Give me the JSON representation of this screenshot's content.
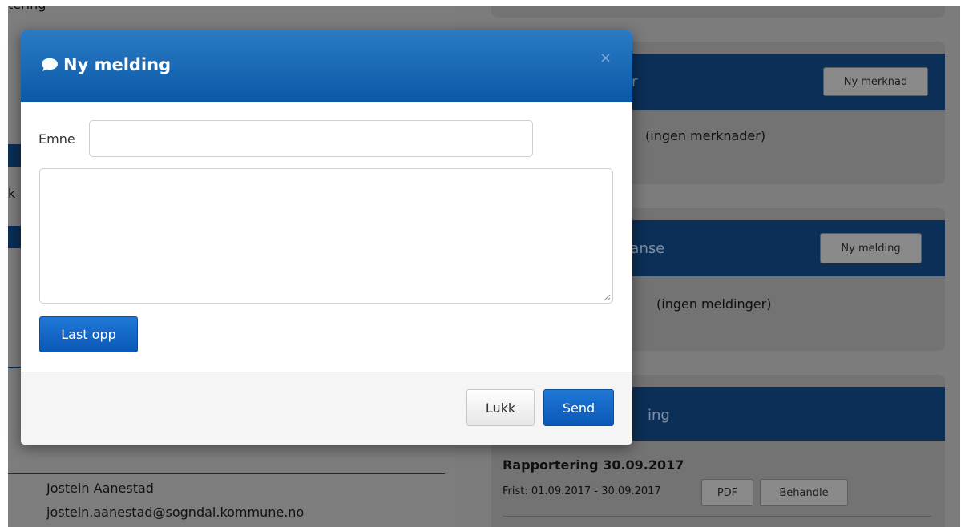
{
  "background": {
    "left": {
      "clipped_top": "tering",
      "clipped_mid": "k",
      "contact_name": "Jostein Aanestad",
      "contact_email": "jostein.aanestad@sogndal.kommune.no"
    },
    "panels": {
      "merknader": {
        "title_fragment": "r",
        "button": "Ny merknad",
        "empty_text": "(ingen merknader)"
      },
      "korrespondanse": {
        "title_fragment": "danse",
        "button": "Ny melding",
        "empty_text": "(ingen meldinger)"
      },
      "rapportering": {
        "title_fragment": "ing",
        "item_title": "Rapportering 30.09.2017",
        "item_deadline": "Frist: 01.09.2017 - 30.09.2017",
        "pdf_button": "PDF",
        "process_button": "Behandle"
      }
    }
  },
  "modal": {
    "title": "Ny melding",
    "title_icon": "comment-icon",
    "close_symbol": "×",
    "subject_label": "Emne",
    "subject_value": "",
    "message_value": "",
    "upload_button": "Last opp",
    "close_button": "Lukk",
    "send_button": "Send"
  },
  "colors": {
    "modal_header": "#1a6bb8",
    "primary_button": "#0a58b8",
    "overlay_header": "#0b2f57"
  }
}
